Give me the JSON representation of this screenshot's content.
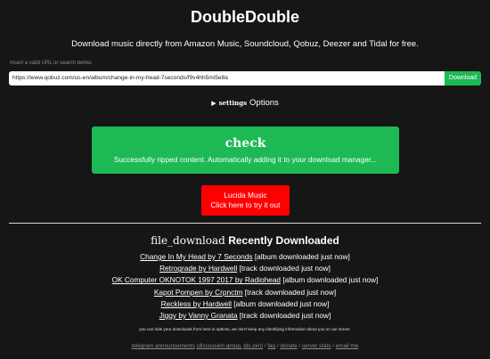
{
  "app": {
    "title": "DoubleDouble",
    "subtitle": "Download music directly from Amazon Music, Soundcloud, Qobuz, Deezer and Tidal for free."
  },
  "search": {
    "hint": "Insert a valid URL or search below.",
    "value": "https://www.qobuz.com/us-en/album/change-in-my-head-7seconds/f9v4hh5mi5e8a",
    "download_label": "Download"
  },
  "options": {
    "settings_icon_text": "settings",
    "label": "Options"
  },
  "status": {
    "icon_text": "check",
    "message": "Successfully ripped content. Automatically adding it to your download manager..."
  },
  "lucida": {
    "line1": "Lucida Music",
    "line2": "Click here to try it out"
  },
  "recent": {
    "icon_text": "file_download",
    "heading": "Recently Downloaded",
    "items": [
      {
        "link": "Change In My Head by 7 Seconds",
        "status": "[album downloaded just now]"
      },
      {
        "link": "Retrograde by Hardwell",
        "status": "[track downloaded just now]"
      },
      {
        "link": "OK Computer OKNOTOK 1997 2017 by Radiohead",
        "status": "[album downloaded just now]"
      },
      {
        "link": "Kapot Pompen by Crpnctm",
        "status": "[track downloaded just now]"
      },
      {
        "link": "Reckless by Hardwell",
        "status": "[album downloaded just now]"
      },
      {
        "link": "Jiggy by Vanny Granata",
        "status": "[track downloaded just now]"
      }
    ]
  },
  "privacy_note": "you can hide your downloads from here in options, we don't keep any identifying information about you on our server.",
  "footer": {
    "telegram": "telegram announcements",
    "discussion": "(discussion group,",
    "discussion_join": "pls join)",
    "faq": "faq",
    "donate": "donate",
    "server_stats": "server stats",
    "email": "email me",
    "sep": "/"
  },
  "colors": {
    "background": "#161616",
    "accent_green": "#1db954",
    "lucida_red": "#ff0000"
  }
}
